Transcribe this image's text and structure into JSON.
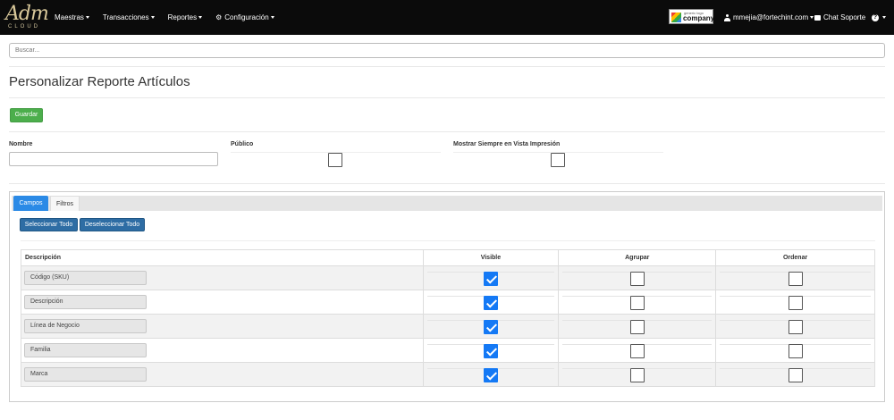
{
  "navbar": {
    "logo_text": "Adm",
    "logo_subtext": "CLOUD",
    "menu": [
      {
        "label": "Maestras"
      },
      {
        "label": "Transacciones"
      },
      {
        "label": "Reportes"
      },
      {
        "label": "Configuración"
      }
    ],
    "company_logo_small": "generic logo",
    "company_logo_big": "company",
    "user_email": "mmejia@fortechint.com",
    "chat_label": "Chat Soporte",
    "help_icon": "question-circle-icon"
  },
  "search": {
    "placeholder": "Buscar..."
  },
  "page": {
    "title": "Personalizar Reporte Artículos",
    "save_label": "Guardar"
  },
  "form": {
    "nombre_label": "Nombre",
    "nombre_value": "",
    "publico_label": "Público",
    "publico_checked": false,
    "mostrar_label": "Mostrar Siempre en Vista Impresión",
    "mostrar_checked": false
  },
  "tabs": [
    {
      "label": "Campos",
      "active": true
    },
    {
      "label": "Filtros",
      "active": false
    }
  ],
  "buttons": {
    "select_all": "Seleccionar Todo",
    "deselect_all": "Deseleccionar Todo"
  },
  "table": {
    "columns": [
      "Descripción",
      "Visible",
      "Agrupar",
      "Ordenar"
    ],
    "rows": [
      {
        "descripcion": "Código (SKU)",
        "visible": true,
        "agrupar": false,
        "ordenar": false
      },
      {
        "descripcion": "Descripción",
        "visible": true,
        "agrupar": false,
        "ordenar": false
      },
      {
        "descripcion": "Línea de Negocio",
        "visible": true,
        "agrupar": false,
        "ordenar": false
      },
      {
        "descripcion": "Familia",
        "visible": true,
        "agrupar": false,
        "ordenar": false
      },
      {
        "descripcion": "Marca",
        "visible": true,
        "agrupar": false,
        "ordenar": false
      }
    ]
  },
  "colors": {
    "navbar_bg": "#0b0b0b",
    "save_button": "#4cae4c",
    "primary_blue": "#2e6da4",
    "checkbox_checked": "#1479f5"
  }
}
